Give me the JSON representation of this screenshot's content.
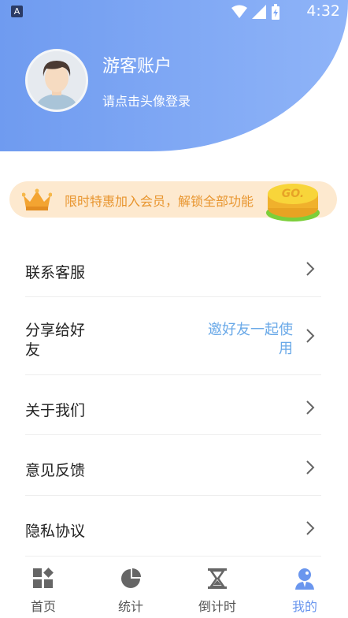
{
  "status_bar": {
    "time": "4:32",
    "icons": [
      "notification-icon",
      "wifi-icon",
      "signal-icon",
      "battery-icon"
    ]
  },
  "profile": {
    "name": "游客账户",
    "hint": "请点击头像登录"
  },
  "banner": {
    "text": "限时特惠加入会员，解锁全部功能",
    "go_label": "GO."
  },
  "menu": {
    "contact": {
      "label": "联系客服"
    },
    "share": {
      "label_line1": "分享给好",
      "label_line2": "友",
      "extra_line1": "邀好友一起使",
      "extra_line2": "用"
    },
    "about": {
      "label": "关于我们"
    },
    "feedback": {
      "label": "意见反馈"
    },
    "privacy": {
      "label": "隐私协议"
    }
  },
  "tabs": [
    {
      "label": "首页",
      "icon": "home-grid-icon"
    },
    {
      "label": "统计",
      "icon": "pie-chart-icon"
    },
    {
      "label": "倒计时",
      "icon": "hourglass-icon"
    },
    {
      "label": "我的",
      "icon": "profile-icon",
      "active": true
    }
  ],
  "colors": {
    "header": "#7aa4f4",
    "accent": "#6a96ee",
    "banner_bg": "#fde9cf",
    "banner_text": "#e8952e",
    "share_extra": "#6aa9e8"
  }
}
